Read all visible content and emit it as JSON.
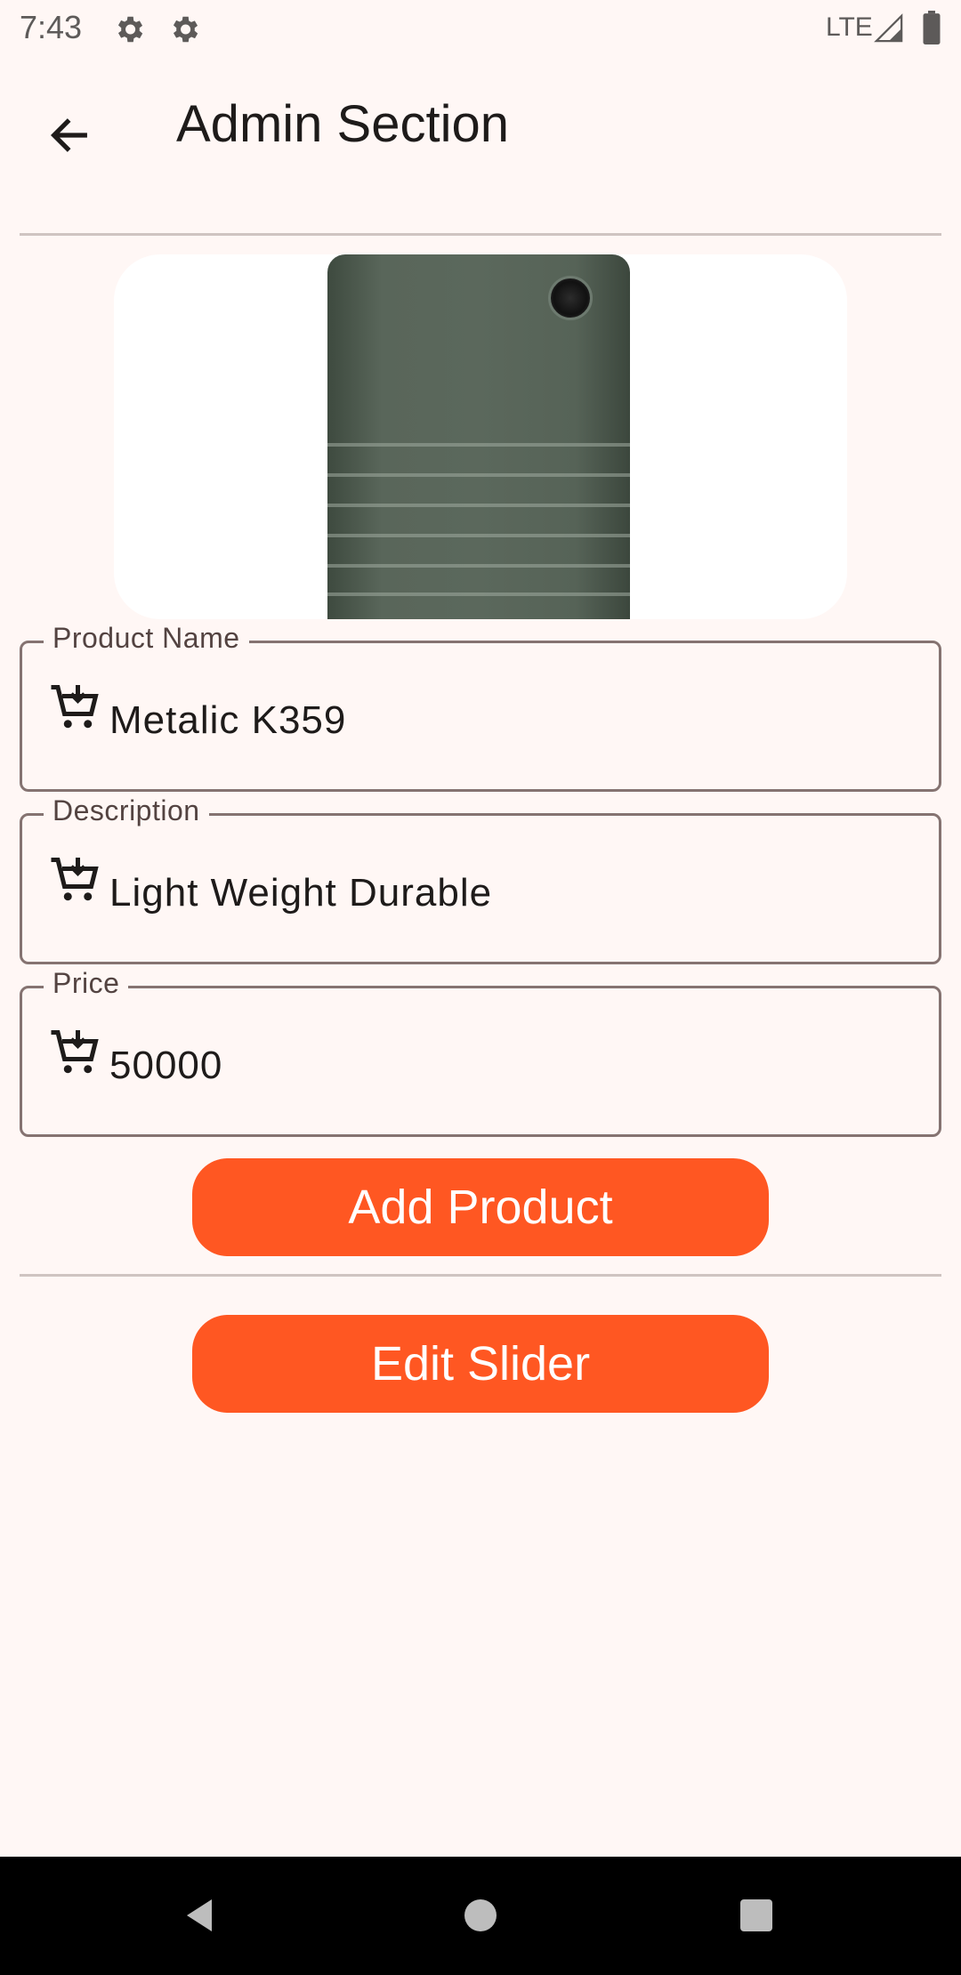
{
  "status_bar": {
    "time": "7:43",
    "network": "LTE",
    "icons": [
      "settings-gear-icon",
      "settings-gear-icon",
      "signal-icon",
      "battery-icon"
    ]
  },
  "app_bar": {
    "title": "Admin Section",
    "back_icon": "arrow-back-icon"
  },
  "product_image": {
    "description_icon": "product-photo"
  },
  "form": {
    "fields": [
      {
        "label": "Product Name",
        "value": "Metalic K359",
        "icon": "add-shopping-cart-icon"
      },
      {
        "label": "Description",
        "value": "Light Weight Durable",
        "icon": "add-shopping-cart-icon"
      },
      {
        "label": "Price",
        "value": "50000",
        "icon": "add-shopping-cart-icon"
      }
    ]
  },
  "buttons": {
    "add_product": "Add Product",
    "edit_slider": "Edit Slider"
  },
  "colors": {
    "accent": "#ff5722",
    "background": "#fff7f5",
    "outline": "#857371"
  },
  "nav_bar": {
    "icons": [
      "nav-back-icon",
      "nav-home-icon",
      "nav-recents-icon"
    ]
  }
}
